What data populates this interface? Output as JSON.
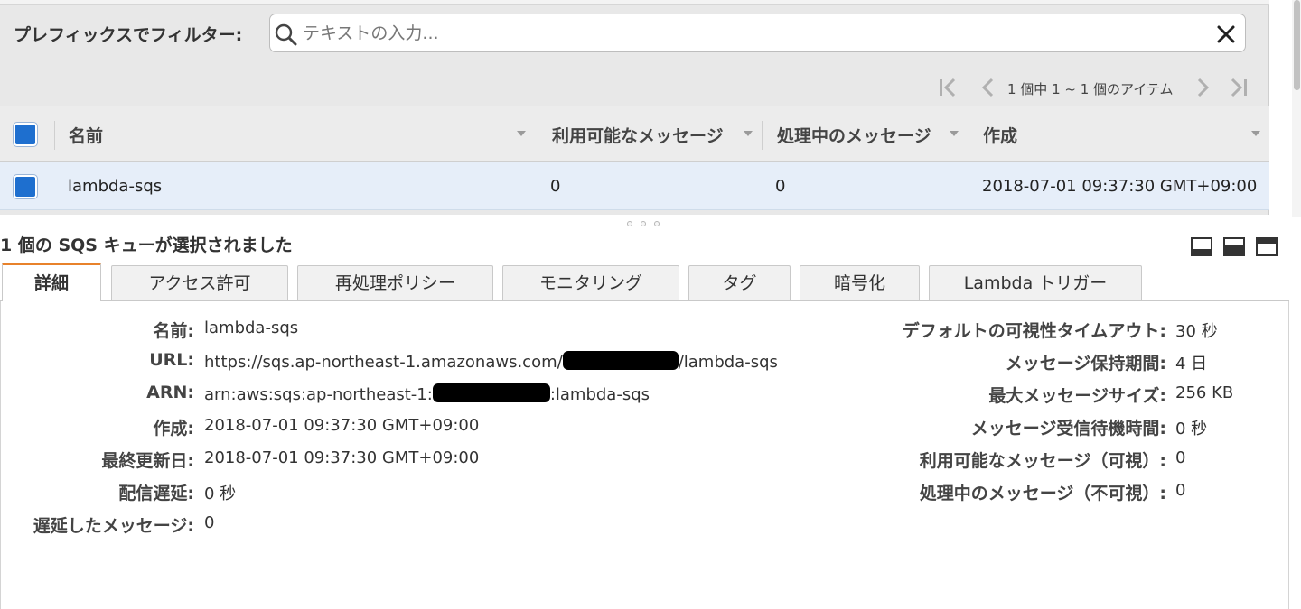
{
  "filter": {
    "label": "プレフィックスでフィルター:",
    "placeholder": "テキストの入力..."
  },
  "pagination": {
    "text": "1 個中 1 ~ 1 個のアイテム"
  },
  "table": {
    "columns": [
      "名前",
      "利用可能なメッセージ",
      "処理中のメッセージ",
      "作成"
    ],
    "rows": [
      {
        "selected": true,
        "name": "lambda-sqs",
        "available": "0",
        "in_flight": "0",
        "created": "2018-07-01 09:37:30 GMT+09:00"
      }
    ]
  },
  "details": {
    "selection_title": "1 個の SQS キューが選択されました",
    "tabs": [
      "詳細",
      "アクセス許可",
      "再処理ポリシー",
      "モニタリング",
      "タグ",
      "暗号化",
      "Lambda トリガー"
    ],
    "active_tab": 0,
    "left": [
      {
        "label": "名前:",
        "value": "lambda-sqs"
      },
      {
        "label": "URL:",
        "value_prefix": "https://sqs.ap-northeast-1.amazonaws.com/",
        "value_suffix": "/lambda-sqs"
      },
      {
        "label": "ARN:",
        "value_prefix": "arn:aws:sqs:ap-northeast-1:",
        "value_suffix": ":lambda-sqs"
      },
      {
        "label": "作成:",
        "value": "2018-07-01 09:37:30 GMT+09:00"
      },
      {
        "label": "最終更新日:",
        "value": "2018-07-01 09:37:30 GMT+09:00"
      },
      {
        "label": "配信遅延:",
        "value": "0 秒"
      },
      {
        "label": "遅延したメッセージ:",
        "value": "0"
      }
    ],
    "right": [
      {
        "label": "デフォルトの可視性タイムアウト:",
        "value": "30 秒"
      },
      {
        "label": "メッセージ保持期間:",
        "value": "4 日"
      },
      {
        "label": "最大メッセージサイズ:",
        "value": "256 KB"
      },
      {
        "label": "メッセージ受信待機時間:",
        "value": "0 秒"
      },
      {
        "label": "利用可能なメッセージ（可視）:",
        "value": "0"
      },
      {
        "label": "処理中のメッセージ（不可視）:",
        "value": "0"
      }
    ]
  },
  "icons": {
    "search": "search-icon",
    "clear": "close-icon",
    "first_page": "first-page-icon",
    "prev_page": "prev-page-icon",
    "next_page": "next-page-icon",
    "last_page": "last-page-icon",
    "layout": [
      "maximize-panel-icon",
      "split-panel-icon",
      "minimize-panel-icon"
    ]
  },
  "colors": {
    "checkbox": "#1e6fcf",
    "active_tab_accent": "#e8822b",
    "selected_row": "#e6eef9"
  }
}
